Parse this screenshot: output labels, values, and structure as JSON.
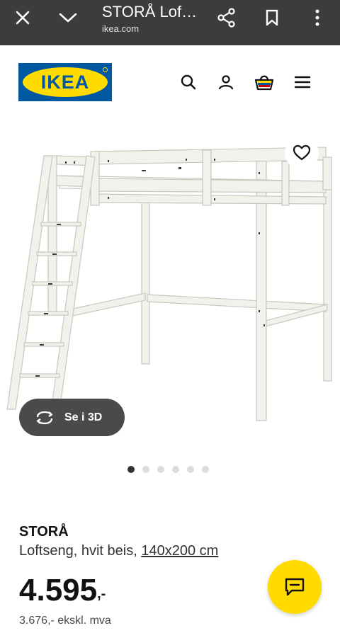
{
  "browser": {
    "title": "STORÅ Lof…",
    "domain": "ikea.com",
    "icons": [
      "close-icon",
      "chevron-down-icon",
      "share-icon",
      "bookmark-icon",
      "more-vertical-icon"
    ]
  },
  "header": {
    "logo_text": "IKEA",
    "icons": [
      "search-icon",
      "user-icon",
      "basket-icon",
      "menu-icon"
    ],
    "brand_blue": "#0058a3",
    "brand_yellow": "#ffdb00"
  },
  "gallery": {
    "view3d_label": "Se i 3D",
    "image_count": 6,
    "active_index": 0
  },
  "product": {
    "name": "STORÅ",
    "description": "Loftseng, hvit beis, ",
    "size": "140x200 cm",
    "price": "4.595",
    "price_suffix": ",-",
    "price_excl": "3.676,- ekskl. mva"
  }
}
